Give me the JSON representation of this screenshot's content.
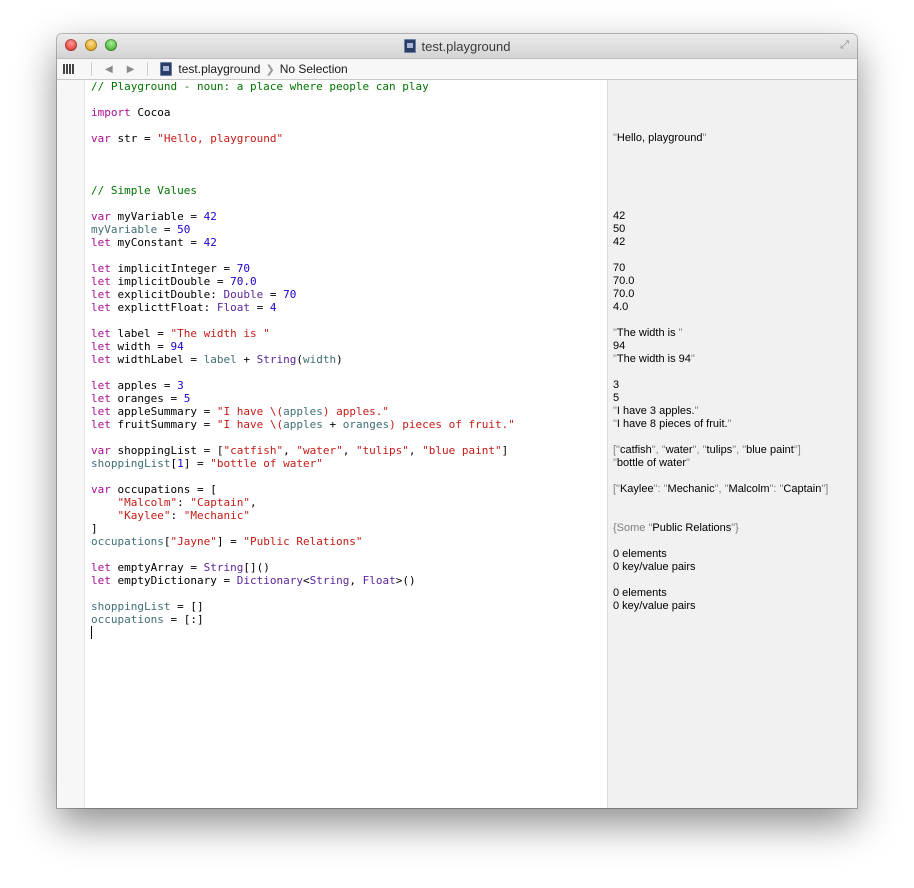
{
  "window": {
    "title": "test.playground"
  },
  "pathbar": {
    "back_icon": "◀",
    "forward_icon": "▶",
    "file": "test.playground",
    "selection": "No Selection"
  },
  "code_lines": [
    [
      [
        "c",
        "// Playground - noun: a place where people can play"
      ]
    ],
    [],
    [
      [
        "k",
        "import"
      ],
      [
        "t",
        " Cocoa"
      ]
    ],
    [],
    [
      [
        "k",
        "var"
      ],
      [
        "t",
        " str = "
      ],
      [
        "s",
        "\"Hello, playground\""
      ]
    ],
    [],
    [],
    [],
    [
      [
        "c",
        "// Simple Values"
      ]
    ],
    [],
    [
      [
        "k",
        "var"
      ],
      [
        "t",
        " myVariable = "
      ],
      [
        "n",
        "42"
      ]
    ],
    [
      [
        "v",
        "myVariable"
      ],
      [
        "t",
        " = "
      ],
      [
        "n",
        "50"
      ]
    ],
    [
      [
        "k",
        "let"
      ],
      [
        "t",
        " myConstant = "
      ],
      [
        "n",
        "42"
      ]
    ],
    [],
    [
      [
        "k",
        "let"
      ],
      [
        "t",
        " implicitInteger = "
      ],
      [
        "n",
        "70"
      ]
    ],
    [
      [
        "k",
        "let"
      ],
      [
        "t",
        " implicitDouble = "
      ],
      [
        "n",
        "70.0"
      ]
    ],
    [
      [
        "k",
        "let"
      ],
      [
        "t",
        " explicitDouble: "
      ],
      [
        "ty",
        "Double"
      ],
      [
        "t",
        " = "
      ],
      [
        "n",
        "70"
      ]
    ],
    [
      [
        "k",
        "let"
      ],
      [
        "t",
        " explicttFloat: "
      ],
      [
        "ty",
        "Float"
      ],
      [
        "t",
        " = "
      ],
      [
        "n",
        "4"
      ]
    ],
    [],
    [
      [
        "k",
        "let"
      ],
      [
        "t",
        " label = "
      ],
      [
        "s",
        "\"The width is \""
      ]
    ],
    [
      [
        "k",
        "let"
      ],
      [
        "t",
        " width = "
      ],
      [
        "n",
        "94"
      ]
    ],
    [
      [
        "k",
        "let"
      ],
      [
        "t",
        " widthLabel = "
      ],
      [
        "v",
        "label"
      ],
      [
        "t",
        " + "
      ],
      [
        "ty",
        "String"
      ],
      [
        "t",
        "("
      ],
      [
        "v",
        "width"
      ],
      [
        "t",
        ")"
      ]
    ],
    [],
    [
      [
        "k",
        "let"
      ],
      [
        "t",
        " apples = "
      ],
      [
        "n",
        "3"
      ]
    ],
    [
      [
        "k",
        "let"
      ],
      [
        "t",
        " oranges = "
      ],
      [
        "n",
        "5"
      ]
    ],
    [
      [
        "k",
        "let"
      ],
      [
        "t",
        " appleSummary = "
      ],
      [
        "s",
        "\"I have \\("
      ],
      [
        "v",
        "apples"
      ],
      [
        "s",
        ") apples.\""
      ]
    ],
    [
      [
        "k",
        "let"
      ],
      [
        "t",
        " fruitSummary = "
      ],
      [
        "s",
        "\"I have \\("
      ],
      [
        "v",
        "apples"
      ],
      [
        "t",
        " + "
      ],
      [
        "v",
        "oranges"
      ],
      [
        "s",
        ") pieces of fruit.\""
      ]
    ],
    [],
    [
      [
        "k",
        "var"
      ],
      [
        "t",
        " shoppingList = ["
      ],
      [
        "s",
        "\"catfish\""
      ],
      [
        "t",
        ", "
      ],
      [
        "s",
        "\"water\""
      ],
      [
        "t",
        ", "
      ],
      [
        "s",
        "\"tulips\""
      ],
      [
        "t",
        ", "
      ],
      [
        "s",
        "\"blue paint\""
      ],
      [
        "t",
        "]"
      ]
    ],
    [
      [
        "v",
        "shoppingList"
      ],
      [
        "t",
        "["
      ],
      [
        "n",
        "1"
      ],
      [
        "t",
        "] = "
      ],
      [
        "s",
        "\"bottle of water\""
      ]
    ],
    [],
    [
      [
        "k",
        "var"
      ],
      [
        "t",
        " occupations = ["
      ]
    ],
    [
      [
        "t",
        "    "
      ],
      [
        "s",
        "\"Malcolm\""
      ],
      [
        "t",
        ": "
      ],
      [
        "s",
        "\"Captain\""
      ],
      [
        "t",
        ","
      ]
    ],
    [
      [
        "t",
        "    "
      ],
      [
        "s",
        "\"Kaylee\""
      ],
      [
        "t",
        ": "
      ],
      [
        "s",
        "\"Mechanic\""
      ]
    ],
    [
      [
        "t",
        "]"
      ]
    ],
    [
      [
        "v",
        "occupations"
      ],
      [
        "t",
        "["
      ],
      [
        "s",
        "\"Jayne\""
      ],
      [
        "t",
        "] = "
      ],
      [
        "s",
        "\"Public Relations\""
      ]
    ],
    [],
    [
      [
        "k",
        "let"
      ],
      [
        "t",
        " emptyArray = "
      ],
      [
        "ty",
        "String"
      ],
      [
        "t",
        "[]()"
      ]
    ],
    [
      [
        "k",
        "let"
      ],
      [
        "t",
        " emptyDictionary = "
      ],
      [
        "ty",
        "Dictionary"
      ],
      [
        "t",
        "<"
      ],
      [
        "ty",
        "String"
      ],
      [
        "t",
        ", "
      ],
      [
        "ty",
        "Float"
      ],
      [
        "t",
        ">()"
      ]
    ],
    [],
    [
      [
        "v",
        "shoppingList"
      ],
      [
        "t",
        " = []"
      ]
    ],
    [
      [
        "v",
        "occupations"
      ],
      [
        "t",
        " = [:]"
      ]
    ],
    [
      [
        "cursor",
        ""
      ]
    ]
  ],
  "result_lines": [
    [],
    [],
    [],
    [],
    [
      [
        "q",
        "\""
      ],
      [
        "t",
        "Hello, playground"
      ],
      [
        "q",
        "\""
      ]
    ],
    [],
    [],
    [],
    [],
    [],
    [
      [
        "t",
        "42"
      ]
    ],
    [
      [
        "t",
        "50"
      ]
    ],
    [
      [
        "t",
        "42"
      ]
    ],
    [],
    [
      [
        "t",
        "70"
      ]
    ],
    [
      [
        "t",
        "70.0"
      ]
    ],
    [
      [
        "t",
        "70.0"
      ]
    ],
    [
      [
        "t",
        "4.0"
      ]
    ],
    [],
    [
      [
        "q",
        "\""
      ],
      [
        "t",
        "The width is "
      ],
      [
        "q",
        "\""
      ]
    ],
    [
      [
        "t",
        "94"
      ]
    ],
    [
      [
        "q",
        "\""
      ],
      [
        "t",
        "The width is 94"
      ],
      [
        "q",
        "\""
      ]
    ],
    [],
    [
      [
        "t",
        "3"
      ]
    ],
    [
      [
        "t",
        "5"
      ]
    ],
    [
      [
        "q",
        "\""
      ],
      [
        "t",
        "I have 3 apples."
      ],
      [
        "q",
        "\""
      ]
    ],
    [
      [
        "q",
        "\""
      ],
      [
        "t",
        "I have 8 pieces of fruit."
      ],
      [
        "q",
        "\""
      ]
    ],
    [],
    [
      [
        "q",
        "[\""
      ],
      [
        "t",
        "catfish"
      ],
      [
        "q",
        "\", \""
      ],
      [
        "t",
        "water"
      ],
      [
        "q",
        "\", \""
      ],
      [
        "t",
        "tulips"
      ],
      [
        "q",
        "\", \""
      ],
      [
        "t",
        "blue paint"
      ],
      [
        "q",
        "\"]"
      ]
    ],
    [
      [
        "q",
        "\""
      ],
      [
        "t",
        "bottle of water"
      ],
      [
        "q",
        "\""
      ]
    ],
    [],
    [
      [
        "q",
        "[\""
      ],
      [
        "t",
        "Kaylee"
      ],
      [
        "q",
        "\": \""
      ],
      [
        "t",
        "Mechanic"
      ],
      [
        "q",
        "\", \""
      ],
      [
        "t",
        "Malcolm"
      ],
      [
        "q",
        "\": \""
      ],
      [
        "t",
        "Captain"
      ],
      [
        "q",
        "\"]"
      ]
    ],
    [],
    [],
    [
      [
        "q",
        "{Some \""
      ],
      [
        "t",
        "Public Relations"
      ],
      [
        "q",
        "\"}"
      ]
    ],
    [],
    [
      [
        "t",
        "0 elements"
      ]
    ],
    [
      [
        "t",
        "0 key/value pairs"
      ]
    ],
    [],
    [
      [
        "t",
        "0 elements"
      ]
    ],
    [
      [
        "t",
        "0 key/value pairs"
      ]
    ]
  ],
  "colors": {
    "c": "#007400",
    "k": "#aa0d91",
    "t": "#000000",
    "s": "#c41a16",
    "n": "#1c00cf",
    "ty": "#5c2699",
    "v": "#3f6e74",
    "q": "#7f7f7f"
  }
}
